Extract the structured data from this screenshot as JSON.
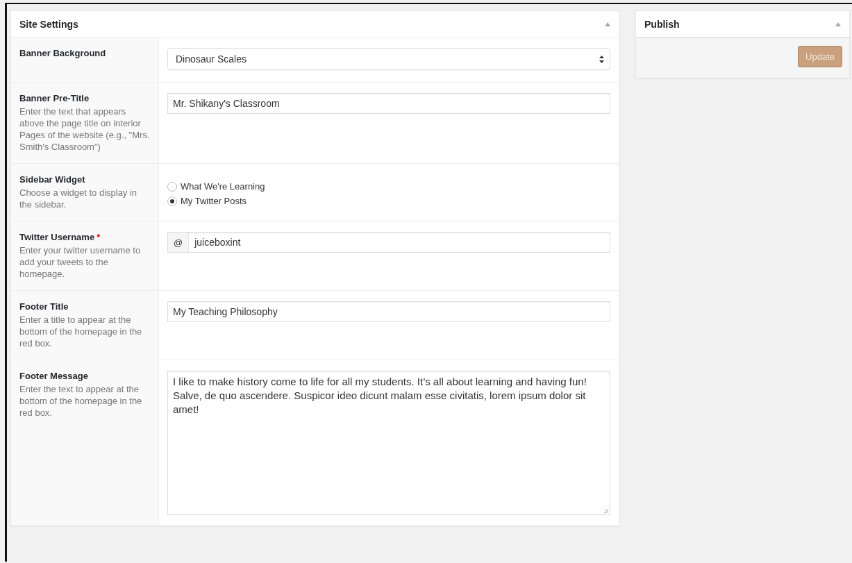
{
  "settings_panel": {
    "title": "Site Settings",
    "expanded": true,
    "fields": [
      {
        "kind": "select",
        "label": "Banner Background",
        "value": "Dinosaur Scales"
      },
      {
        "kind": "text",
        "label": "Banner Pre-Title",
        "description": "Enter the text that appears above the page title on interior Pages of the website (e.g., \"Mrs. Smith's Classroom\")",
        "value": "Mr. Shikany's Classroom"
      },
      {
        "kind": "radio",
        "label": "Sidebar Widget",
        "description": "Choose a widget to display in the sidebar.",
        "options": [
          {
            "label": "What We're Learning",
            "selected": false
          },
          {
            "label": "My Twitter Posts",
            "selected": true
          }
        ]
      },
      {
        "kind": "prefixed",
        "label": "Twitter Username",
        "required": true,
        "required_mark": "*",
        "description": "Enter your twitter username to add your tweets to the homepage.",
        "prefix": "@",
        "value": "juiceboxint"
      },
      {
        "kind": "text",
        "label": "Footer Title",
        "description": "Enter a title to appear at the bottom of the homepage in the red box.",
        "value": "My Teaching Philosophy"
      },
      {
        "kind": "textarea",
        "label": "Footer Message",
        "description": "Enter the text to appear at the bottom of the homepage in the red box.",
        "value": "I like to make history come to life for all my students. It’s all about learning and having fun! Salve, de quo ascendere. Suspicor ideo dicunt malam esse civitatis, lorem ipsum dolor sit amet!"
      }
    ]
  },
  "publish_panel": {
    "title": "Publish",
    "expanded": true,
    "button": "Update"
  }
}
